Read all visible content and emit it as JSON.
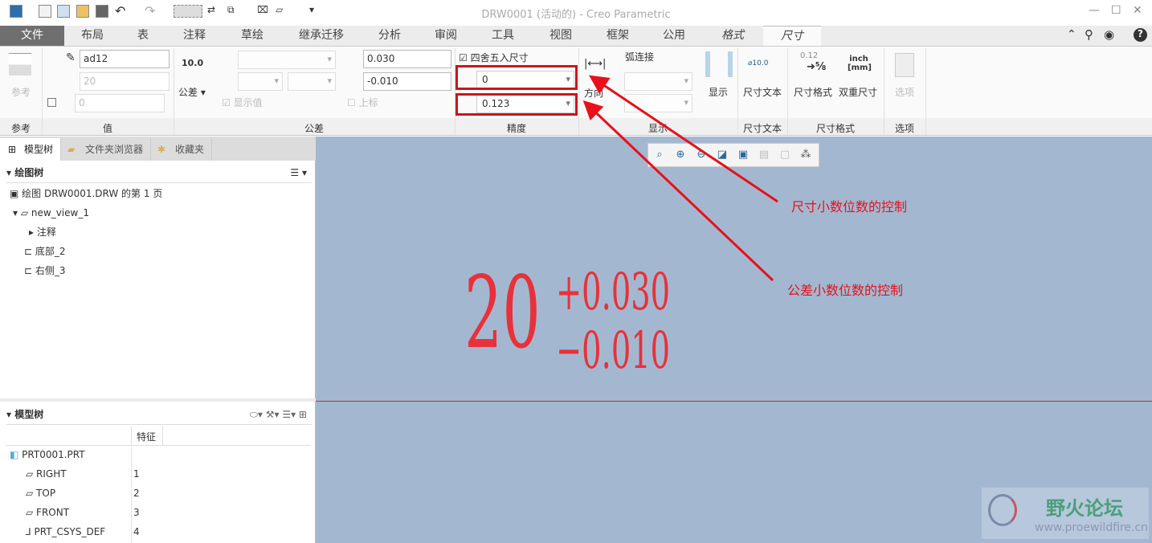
{
  "window": {
    "title": "DRW0001 (活动的) - Creo Parametric",
    "min": "—",
    "max": "☐",
    "close": "✕"
  },
  "tabs": [
    "文件",
    "布局",
    "表",
    "注释",
    "草绘",
    "继承迁移",
    "分析",
    "审阅",
    "工具",
    "视图",
    "框架",
    "公用",
    "格式",
    "尺寸"
  ],
  "ribbon": {
    "reference": {
      "label": "参考",
      "group": "参考"
    },
    "value": {
      "name": "ad12",
      "nominal": "20",
      "override": "0",
      "group": "值"
    },
    "tolerance": {
      "icon_text": "10.0",
      "label": "公差",
      "show_value": "显示值",
      "group": "公差",
      "upper": "0.030",
      "lower": "-0.010",
      "superscript": "上标"
    },
    "precision": {
      "round": "四舍五入尺寸",
      "decimals": "0",
      "tol_decimals": "0.123",
      "group": "精度"
    },
    "display": {
      "direction": "方向",
      "arc": "弧连接",
      "show": "显示",
      "group": "显示"
    },
    "dim_text": {
      "label": "尺寸文本",
      "group": "尺寸文本",
      "icon_text": "⌀10.0"
    },
    "dim_format": {
      "format": "尺寸格式",
      "dual": "双重尺寸",
      "group": "尺寸格式",
      "dual_icon": "inch [mm]",
      "frac_icon": "0.12"
    },
    "options": {
      "label": "选项",
      "group": "选项"
    }
  },
  "left_panel": {
    "tabs": [
      "模型树",
      "文件夹浏览器",
      "收藏夹"
    ],
    "drawing_tree": {
      "title": "绘图树",
      "items": [
        "绘图 DRW0001.DRW 的第 1 页",
        "new_view_1",
        "注释",
        "底部_2",
        "右侧_3"
      ]
    },
    "model_tree": {
      "title": "模型树",
      "col_feature": "特征",
      "rows": [
        {
          "name": "PRT0001.PRT",
          "feature": ""
        },
        {
          "name": "RIGHT",
          "feature": "1"
        },
        {
          "name": "TOP",
          "feature": "2"
        },
        {
          "name": "FRONT",
          "feature": "3"
        },
        {
          "name": "PRT_CSYS_DEF",
          "feature": "4"
        }
      ]
    }
  },
  "drawing": {
    "nominal": "20",
    "upper": "+0.030",
    "lower": "−0.010"
  },
  "annotations": {
    "a1": "尺寸小数位数的控制",
    "a2": "公差小数位数的控制"
  },
  "watermark": {
    "name": "野火论坛",
    "url": "www.proewildfire.cn"
  },
  "colors": {
    "accent": "#e8101a",
    "canvas": "#a3b8d0"
  }
}
